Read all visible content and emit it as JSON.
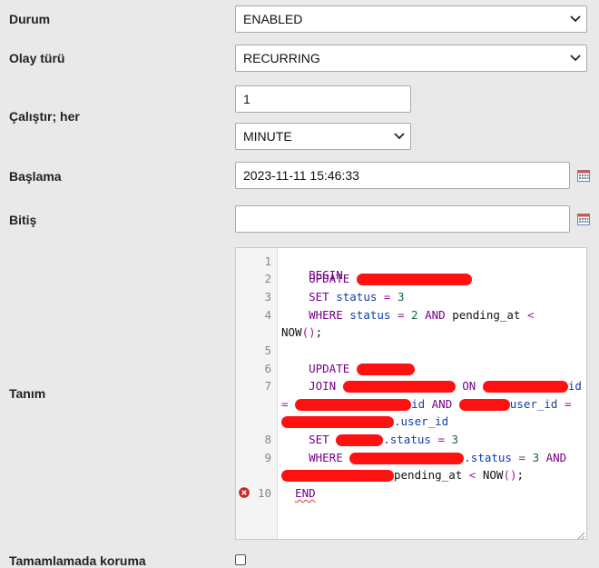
{
  "status": {
    "label": "Durum",
    "value": "ENABLED"
  },
  "event_type": {
    "label": "Olay türü",
    "value": "RECURRING"
  },
  "execute_every": {
    "label": "Çalıştır; her",
    "interval_value": "1",
    "interval_unit": "MINUTE"
  },
  "starts": {
    "label": "Başlama",
    "value": "2023-11-11 15:46:33"
  },
  "ends": {
    "label": "Bitiş",
    "value": ""
  },
  "definition": {
    "label": "Tanım",
    "line_numbers": [
      "1",
      "2",
      "3",
      "4",
      "5",
      "6",
      "7",
      "8",
      "9",
      "10"
    ],
    "tokens": {
      "begin": "BEGIN",
      "update": "UPDATE",
      "set": "SET",
      "where": "WHERE",
      "join": "JOIN",
      "on": "ON",
      "and": "AND",
      "end": "END",
      "status": "status",
      "pending_at": "pending_at",
      "now": "NOW",
      "id": "id",
      "user_id": "user_id",
      "dot_user_id": ".user_id",
      "dot_status": ".status",
      "eq": "=",
      "lt": "<",
      "three": "3",
      "two": "2",
      "paren": "()",
      "semi": ";"
    }
  },
  "on_completion_preserve": {
    "label": "Tamamlamada koruma",
    "checked": false
  },
  "icons": {
    "chevron": "chevron-down-icon",
    "calendar": "calendar-icon",
    "error": "error-icon",
    "resize": "resize-handle-icon"
  },
  "colors": {
    "keyword": "#770088",
    "number": "#116644",
    "variable": "#0f3fa8",
    "redaction": "#ff1111",
    "error": "#cc2222"
  }
}
